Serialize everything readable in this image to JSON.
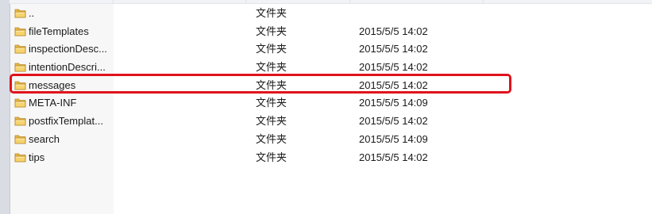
{
  "folder_icon": "folder-icon",
  "highlight_color": "#e0121c",
  "files": [
    {
      "name": "..",
      "type": "文件夹",
      "date": ""
    },
    {
      "name": "fileTemplates",
      "type": "文件夹",
      "date": "2015/5/5 14:02"
    },
    {
      "name": "inspectionDesc...",
      "type": "文件夹",
      "date": "2015/5/5 14:02"
    },
    {
      "name": "intentionDescri...",
      "type": "文件夹",
      "date": "2015/5/5 14:02"
    },
    {
      "name": "messages",
      "type": "文件夹",
      "date": "2015/5/5 14:02"
    },
    {
      "name": "META-INF",
      "type": "文件夹",
      "date": "2015/5/5 14:09"
    },
    {
      "name": "postfixTemplat...",
      "type": "文件夹",
      "date": "2015/5/5 14:02"
    },
    {
      "name": "search",
      "type": "文件夹",
      "date": "2015/5/5 14:09"
    },
    {
      "name": "tips",
      "type": "文件夹",
      "date": "2015/5/5 14:02"
    }
  ]
}
